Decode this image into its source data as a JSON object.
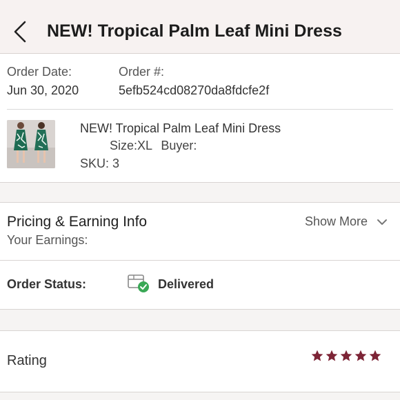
{
  "header": {
    "title": "NEW! Tropical Palm Leaf Mini Dress"
  },
  "order": {
    "date_label": "Order Date:",
    "date_value": "Jun 30, 2020",
    "number_label": "Order #:",
    "number_value": "5efb524cd08270da8fdcfe2f"
  },
  "item": {
    "title": "NEW! Tropical Palm Leaf Mini Dress",
    "size_text": "Size:XL",
    "buyer_label": "Buyer:",
    "sku_text": "SKU: 3"
  },
  "pricing": {
    "title": "Pricing & Earning Info",
    "earnings_label": "Your Earnings:",
    "show_more": "Show More"
  },
  "status": {
    "label": "Order Status:",
    "value": "Delivered",
    "icon": "delivered-box-icon",
    "check_color": "#3aa856"
  },
  "rating": {
    "label": "Rating",
    "stars": 5,
    "star_color": "#7d2436"
  }
}
